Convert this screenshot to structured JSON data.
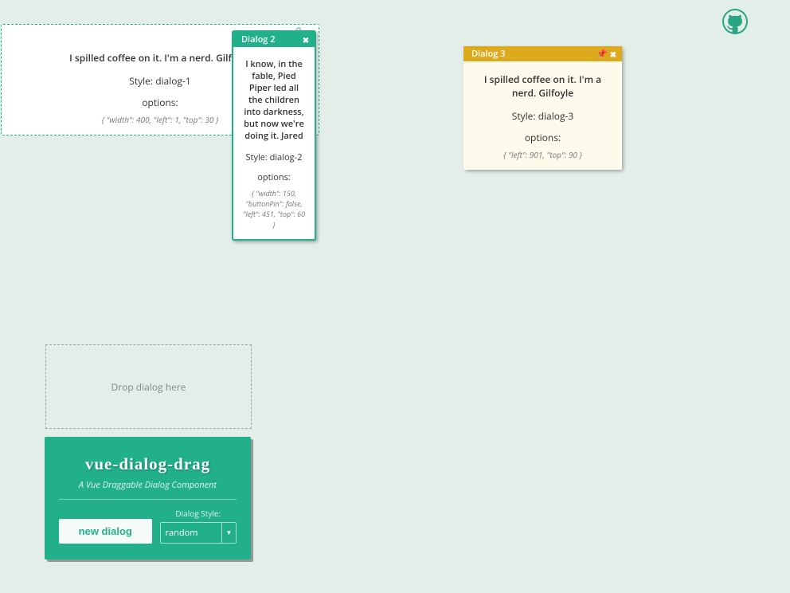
{
  "github_url_title": "GitHub repository",
  "dialogs": {
    "d1": {
      "quote": "I spilled coffee on it. I'm a nerd. Gilfoyle",
      "style_line": "Style: dialog-1",
      "opt_label": "options:",
      "opt_json": "{ \"width\": 400, \"left\": 1, \"top\": 30 }"
    },
    "d2": {
      "title": "Dialog 2",
      "quote": "I know, in the fable, Pied Piper led all the children into darkness, but now we're doing it. Jared",
      "style_line": "Style: dialog-2",
      "opt_label": "options:",
      "opt_json": "{ \"width\": 150, \"buttonPin\": false, \"left\": 451, \"top\": 60 }"
    },
    "d3": {
      "title": "Dialog 3",
      "quote": "I spilled coffee on it. I'm a nerd. Gilfoyle",
      "style_line": "Style: dialog-3",
      "opt_label": "options:",
      "opt_json": "{ \"left\": 901, \"top\": 90 }"
    }
  },
  "drop_zone": {
    "label": "Drop dialog here"
  },
  "panel": {
    "title": "vue-dialog-drag",
    "subtitle": "A Vue Draggable Dialog Component",
    "new_button": "new dialog",
    "style_label": "Dialog Style:",
    "style_value": "random"
  }
}
